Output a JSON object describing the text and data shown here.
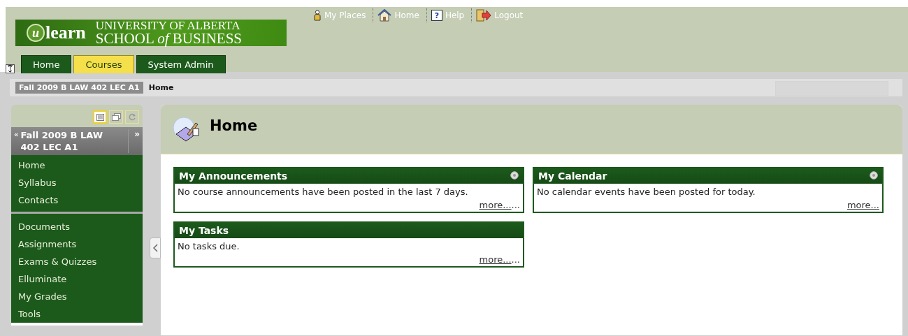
{
  "logo": {
    "mark": "u",
    "name": "learn",
    "line1": "UNIVERSITY OF ALBERTA",
    "line2": "SCHOOL *of* BUSINESS"
  },
  "top_links": [
    {
      "kind": "places",
      "label": "My Places"
    },
    {
      "kind": "home",
      "label": "Home"
    },
    {
      "kind": "help",
      "label": "Help",
      "glyph": "?"
    },
    {
      "kind": "logout",
      "label": "Logout"
    }
  ],
  "tabs": [
    {
      "label": "Home",
      "selected": false
    },
    {
      "label": "Courses",
      "selected": true
    },
    {
      "label": "System Admin",
      "selected": false
    }
  ],
  "breadcrumb": {
    "course": "Fall 2009 B LAW 402 LEC A1",
    "current": "Home"
  },
  "sidebar": {
    "view_buttons": [
      {
        "kind": "list",
        "selected": true
      },
      {
        "kind": "window",
        "selected": false
      },
      {
        "kind": "refresh",
        "selected": false
      }
    ],
    "course_title": "Fall 2009 B LAW 402 LEC A1",
    "expand_glyph": "»",
    "collapse_glyph": "«",
    "groups": [
      [
        "Home",
        "Syllabus",
        "Contacts"
      ],
      [
        "Documents",
        "Assignments",
        "Exams & Quizzes",
        "Elluminate",
        "My Grades",
        "Tools"
      ]
    ]
  },
  "page_title": "Home",
  "columns": [
    [
      {
        "title": "My Announcements",
        "body": "No course announcements have been posted in the last 7 days.",
        "more": "more...",
        "suffix": "..."
      },
      {
        "title": "My Tasks",
        "body": "No tasks due.",
        "more": "more...",
        "suffix": "..."
      }
    ],
    [
      {
        "title": "My Calendar",
        "body": "No calendar events have been posted for today.",
        "more": "more..."
      }
    ]
  ]
}
